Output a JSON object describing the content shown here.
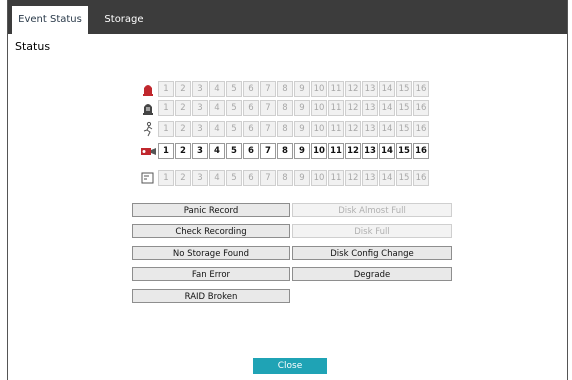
{
  "tabs": [
    {
      "label": "Event Status"
    },
    {
      "label": "Storage"
    }
  ],
  "section_title": "Status",
  "channel_numbers": [
    "1",
    "2",
    "3",
    "4",
    "5",
    "6",
    "7",
    "8",
    "9",
    "10",
    "11",
    "12",
    "13",
    "14",
    "15",
    "16"
  ],
  "rows": [
    {
      "icon": "alarm-siren-icon",
      "color": "#c0272d",
      "active": []
    },
    {
      "icon": "event-siren-icon",
      "color": "#444444",
      "active": []
    },
    {
      "icon": "motion-icon",
      "color": "#555555",
      "active": []
    },
    {
      "icon": "camera-icon",
      "color": "#c0272d",
      "active": [
        1,
        2,
        3,
        4,
        5,
        6,
        7,
        8,
        9,
        10,
        11,
        12,
        13,
        14,
        15,
        16
      ]
    },
    {
      "icon": "text-in-icon",
      "color": "#555555",
      "active": []
    }
  ],
  "events": {
    "panic_record": "Panic Record",
    "disk_almost_full": "Disk Almost Full",
    "check_recording": "Check Recording",
    "disk_full": "Disk Full",
    "no_storage_found": "No Storage Found",
    "disk_config_change": "Disk Config Change",
    "fan_error": "Fan Error",
    "degrade": "Degrade",
    "raid_broken": "RAID Broken"
  },
  "close_label": "Close",
  "colors": {
    "accent": "#1fa3b5",
    "tabbar": "#3c3c3c"
  }
}
